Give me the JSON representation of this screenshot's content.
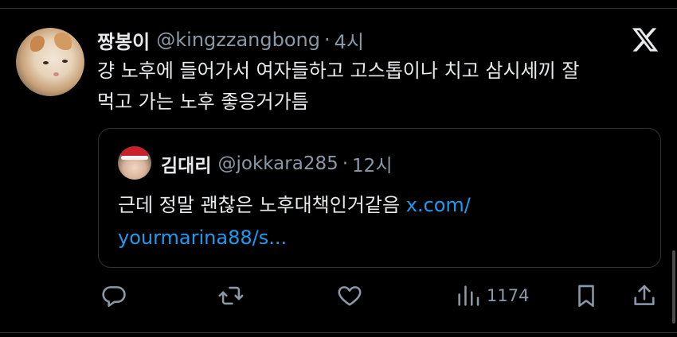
{
  "tweet": {
    "author_name": "짱봉이",
    "author_handle": "@kingzzangbong",
    "separator": "·",
    "time": "4시",
    "text_line1": "걍 노후에 들어가서 여자들하고 고스톱이나 치고 삼시세끼 잘",
    "text_line2": "먹고 가는 노후 좋응거가틈"
  },
  "quote": {
    "author_name": "김대리",
    "author_handle": "@jokkara285",
    "separator": "·",
    "time": "12시",
    "text": "근데 정말 괜찮은 노후대책인거같음 ",
    "link_part1": "x.com/",
    "link_part2": "yourmarina88/s..."
  },
  "actions": {
    "views_count": "1174"
  },
  "icons": {
    "platform": "x-logo-icon",
    "reply": "reply-icon",
    "retweet": "retweet-icon",
    "like": "heart-icon",
    "views": "views-icon",
    "bookmark": "bookmark-icon",
    "share": "share-icon"
  },
  "colors": {
    "background": "#000000",
    "text": "#e7e9ea",
    "secondary": "#8b98a5",
    "link": "#1d9bf0",
    "border": "#2f3336"
  }
}
